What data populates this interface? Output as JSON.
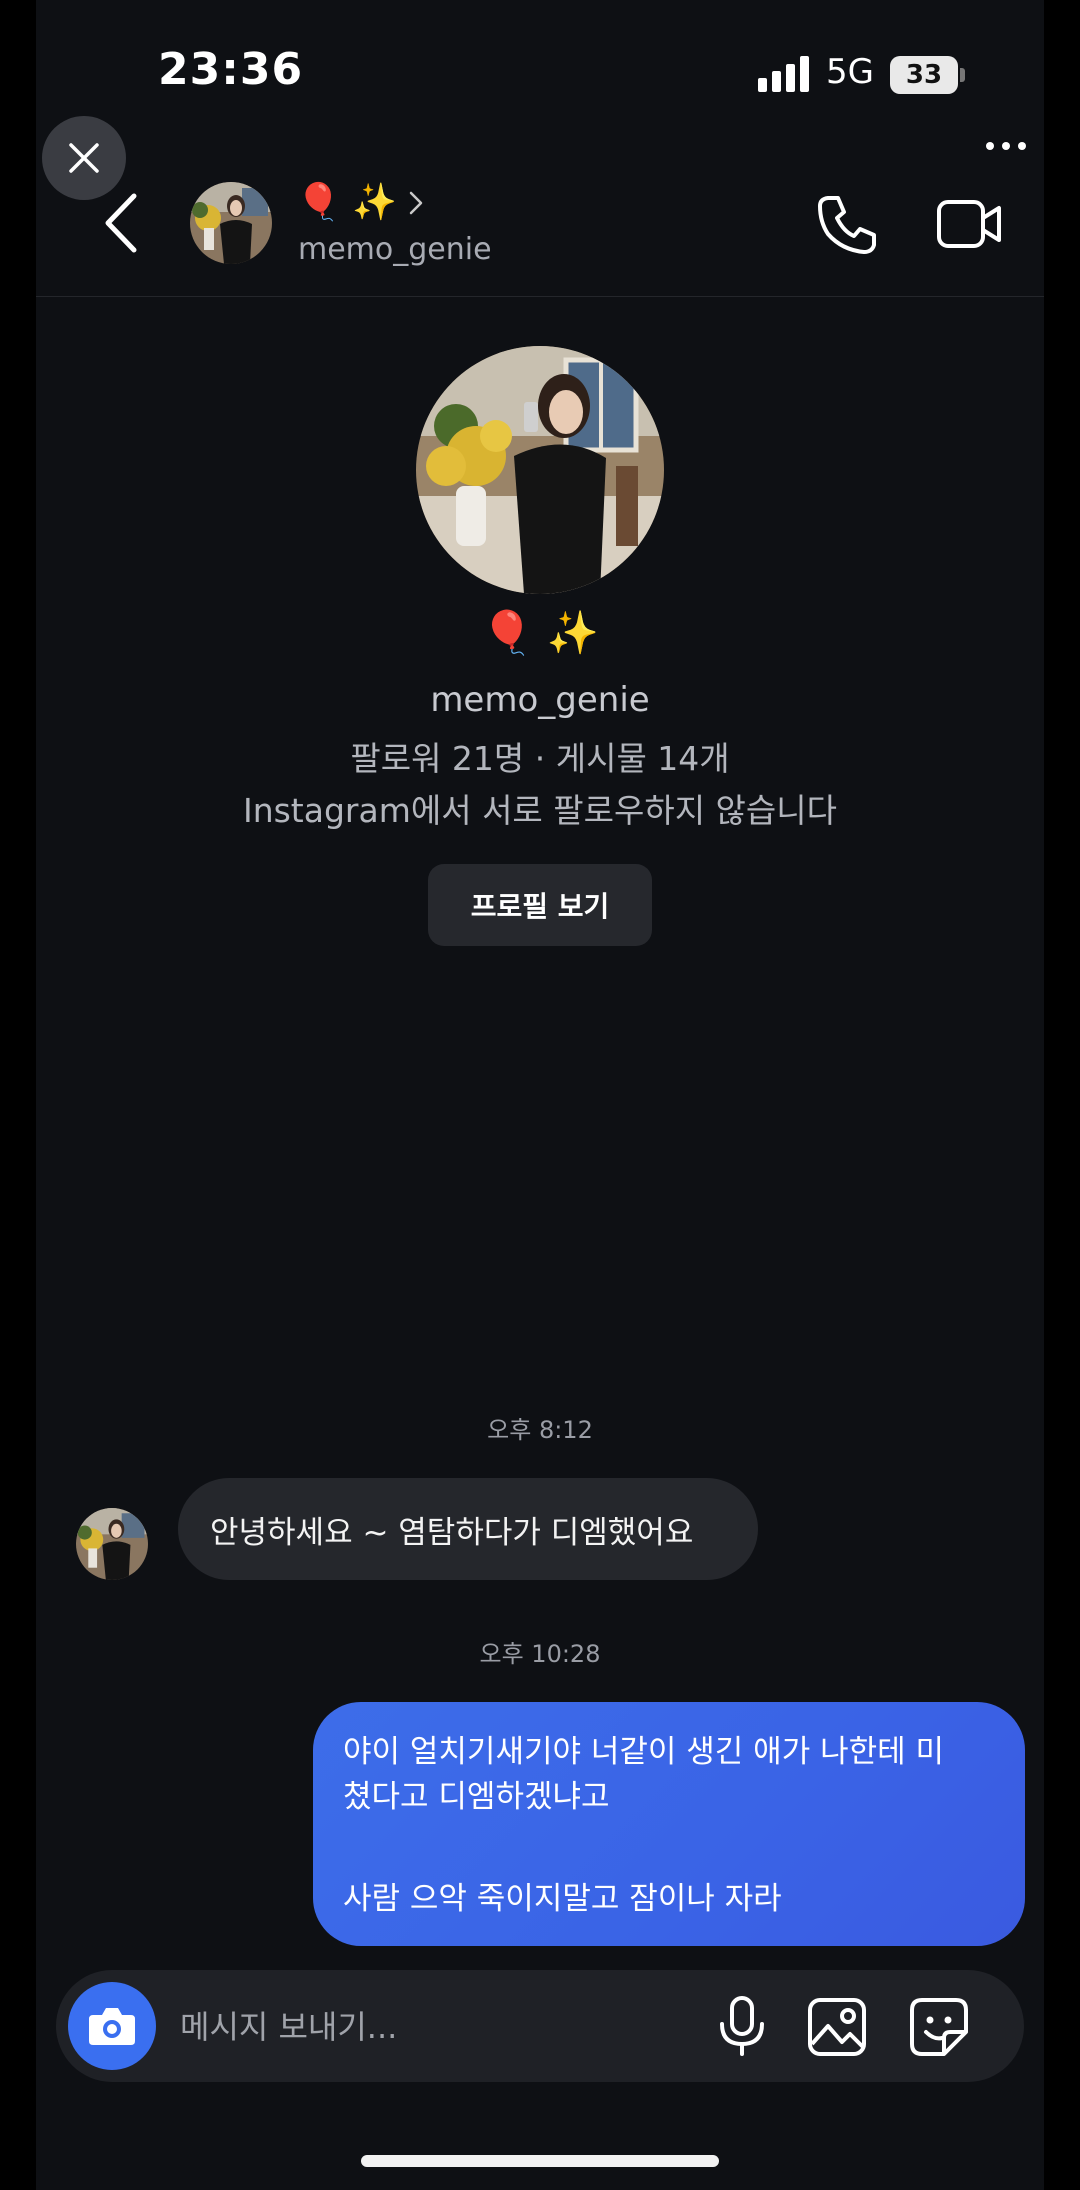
{
  "status_bar": {
    "time": "23:36",
    "network": "5G",
    "battery": "33"
  },
  "header": {
    "display_name_emoji": "🎈 ✨",
    "username": "memo_genie"
  },
  "profile": {
    "display_name_emoji": "🎈 ✨",
    "username": "memo_genie",
    "stats": "팔로워 21명 · 게시물 14개",
    "note": "Instagram에서 서로 팔로우하지 않습니다",
    "view_profile_label": "프로필 보기"
  },
  "messages": [
    {
      "timestamp": "오후 8:12",
      "direction": "incoming",
      "text": "안녕하세요 ~ 염탐하다가 디엠했어요"
    },
    {
      "timestamp": "오후 10:28",
      "direction": "outgoing",
      "lines": [
        "야이 얼치기새기야 너같이 생긴 애가 나한테 미",
        "쳤다고 디엠하겠냐고",
        "사람 으악 죽이지말고 잠이나 자라"
      ]
    }
  ],
  "composer": {
    "placeholder": "메시지 보내기..."
  },
  "colors": {
    "background": "#0e1014",
    "outgoing_bubble": "#3a63e6",
    "incoming_bubble": "#25272c",
    "camera_button": "#3a6ff0"
  },
  "icons": [
    "close-icon",
    "more-icon",
    "back-icon",
    "phone-icon",
    "video-camera-icon",
    "camera-icon",
    "microphone-icon",
    "gallery-icon",
    "sticker-icon"
  ]
}
